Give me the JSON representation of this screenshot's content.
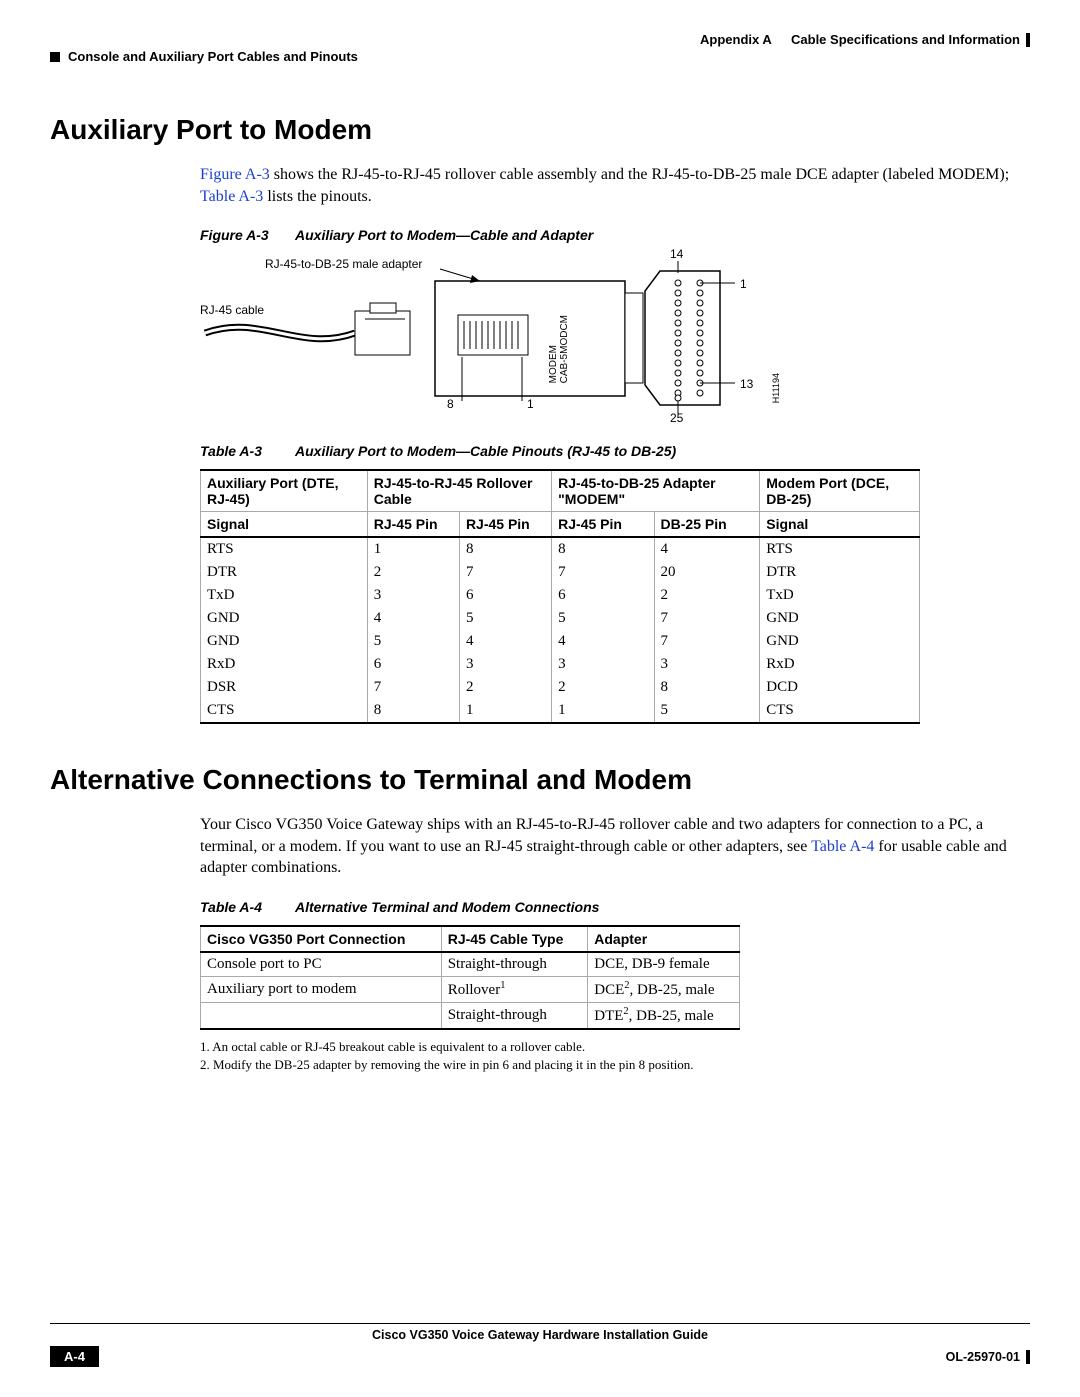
{
  "header": {
    "appendix": "Appendix A",
    "appendix_title": "Cable Specifications and Information",
    "section": "Console and Auxiliary Port Cables and Pinouts"
  },
  "section1": {
    "title": "Auxiliary Port to Modem",
    "intro_pre": "Figure A-3",
    "intro_mid": " shows the RJ-45-to-RJ-45 rollover cable assembly and the RJ-45-to-DB-25 male DCE adapter (labeled MODEM); ",
    "intro_link2": "Table A-3",
    "intro_post": " lists the pinouts.",
    "figure_label": "Figure A-3",
    "figure_title": "Auxiliary Port to Modem—Cable and Adapter",
    "fig": {
      "adapter": "RJ-45-to-DB-25 male adapter",
      "cable": "RJ-45 cable",
      "modem_line1": "MODEM",
      "modem_line2": "CAB-5MODCM",
      "n1": "1",
      "n8": "8",
      "n14": "14",
      "n13": "13",
      "n25": "25",
      "n1b": "1",
      "hnum": "H11194"
    },
    "table_label": "Table A-3",
    "table_title": "Auxiliary Port to Modem—Cable Pinouts (RJ-45 to DB-25)"
  },
  "table3": {
    "head_r1": [
      "Auxiliary Port (DTE, RJ-45)",
      "RJ-45-to-RJ-45 Rollover Cable",
      "RJ-45-to-DB-25 Adapter \"MODEM\"",
      "Modem Port (DCE, DB-25)"
    ],
    "head_r2": [
      "Signal",
      "RJ-45 Pin",
      "RJ-45 Pin",
      "RJ-45 Pin",
      "DB-25 Pin",
      "Signal"
    ],
    "rows": [
      [
        "RTS",
        "1",
        "8",
        "8",
        "4",
        "RTS"
      ],
      [
        "DTR",
        "2",
        "7",
        "7",
        "20",
        "DTR"
      ],
      [
        "TxD",
        "3",
        "6",
        "6",
        "2",
        "TxD"
      ],
      [
        "GND",
        "4",
        "5",
        "5",
        "7",
        "GND"
      ],
      [
        "GND",
        "5",
        "4",
        "4",
        "7",
        "GND"
      ],
      [
        "RxD",
        "6",
        "3",
        "3",
        "3",
        "RxD"
      ],
      [
        "DSR",
        "7",
        "2",
        "2",
        "8",
        "DCD"
      ],
      [
        "CTS",
        "8",
        "1",
        "1",
        "5",
        "CTS"
      ]
    ]
  },
  "section2": {
    "title": "Alternative Connections to Terminal and Modem",
    "intro_pre": "Your Cisco VG350 Voice Gateway ships with an RJ-45-to-RJ-45 rollover cable and two adapters for connection to a PC, a terminal, or a modem. If you want to use an RJ-45 straight-through cable or other adapters, see ",
    "intro_link": "Table A-4",
    "intro_post": " for usable cable and adapter combinations.",
    "table_label": "Table A-4",
    "table_title": "Alternative Terminal and Modem Connections"
  },
  "table4": {
    "head": [
      "Cisco VG350 Port Connection",
      "RJ-45 Cable Type",
      "Adapter"
    ],
    "rows": [
      {
        "c0": "Console port to PC",
        "c1": "Straight-through",
        "c2": "DCE, DB-9 female",
        "sup1": "",
        "sup2": ""
      },
      {
        "c0": "Auxiliary port to modem",
        "c1": "Rollover",
        "c2_pre": "DCE",
        "c2_post": ", DB-25, male",
        "sup1": "1",
        "sup2": "2"
      },
      {
        "c0": "",
        "c1": "Straight-through",
        "c2_pre": "DTE",
        "c2_post": ", DB-25, male",
        "sup1": "",
        "sup2": "2"
      }
    ],
    "footnotes": [
      "1.  An octal cable or RJ-45 breakout cable is equivalent to a rollover cable.",
      "2.  Modify the DB-25 adapter by removing the wire in pin 6 and placing it in the pin 8 position."
    ]
  },
  "footer": {
    "book": "Cisco VG350 Voice Gateway Hardware Installation Guide",
    "page": "A-4",
    "ol": "OL-25970-01"
  }
}
